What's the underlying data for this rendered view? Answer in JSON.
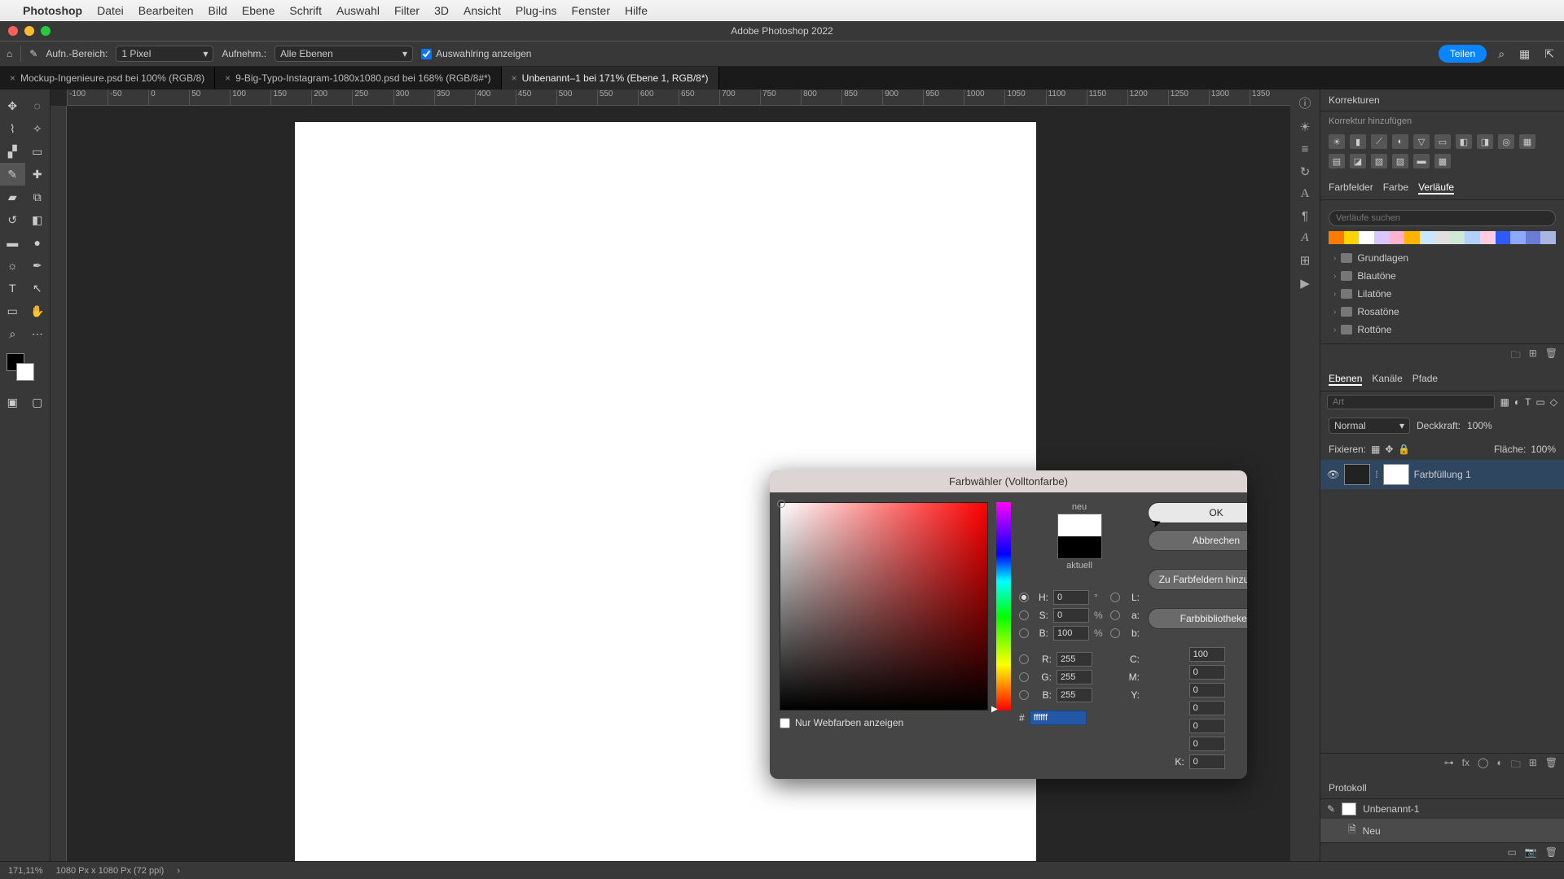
{
  "menubar": {
    "app": "Photoshop",
    "items": [
      "Datei",
      "Bearbeiten",
      "Bild",
      "Ebene",
      "Schrift",
      "Auswahl",
      "Filter",
      "3D",
      "Ansicht",
      "Plug-ins",
      "Fenster",
      "Hilfe"
    ]
  },
  "window_title": "Adobe Photoshop 2022",
  "optbar": {
    "aufn_label": "Aufn.-Bereich:",
    "aufn_val": "1 Pixel",
    "aufnehm_label": "Aufnehm.:",
    "aufnehm_val": "Alle Ebenen",
    "ring": "Auswahlring anzeigen",
    "share": "Teilen"
  },
  "tabs": [
    {
      "label": "Mockup-Ingenieure.psd bei 100% (RGB/8)"
    },
    {
      "label": "9-Big-Typo-Instagram-1080x1080.psd bei 168% (RGB/8#*)"
    },
    {
      "label": "Unbenannt–1 bei 171% (Ebene 1, RGB/8*)",
      "active": true
    }
  ],
  "ruler_ticks": [
    "-100",
    "-50",
    "0",
    "50",
    "100",
    "150",
    "200",
    "250",
    "300",
    "350",
    "400",
    "450",
    "500",
    "550",
    "600",
    "650",
    "700",
    "750",
    "800",
    "850",
    "900",
    "950",
    "1000",
    "1050",
    "1100",
    "1150",
    "1200",
    "1250",
    "1300",
    "1350"
  ],
  "panels": {
    "korrekturen": "Korrekturen",
    "korrektur_add": "Korrektur hinzufügen",
    "swatch_tabs": [
      "Farbfelder",
      "Farbe",
      "Verläufe"
    ],
    "search_ph": "Verläufe suchen",
    "tree": [
      "Grundlagen",
      "Blautöne",
      "Lilatöne",
      "Rosatöne",
      "Rottöne"
    ],
    "layer_tabs": [
      "Ebenen",
      "Kanäle",
      "Pfade"
    ],
    "art_ph": "Art",
    "blend": "Normal",
    "opacity_l": "Deckkraft:",
    "opacity_v": "100%",
    "lock_l": "Fixieren:",
    "fill_l": "Fläche:",
    "fill_v": "100%",
    "layer_name": "Farbfüllung 1",
    "protokoll": "Protokoll",
    "prot_items": [
      "Unbenannt-1",
      "Neu"
    ]
  },
  "status": {
    "zoom": "171,11%",
    "dim": "1080 Px x 1080 Px (72 ppi)"
  },
  "picker": {
    "title": "Farbwähler (Volltonfarbe)",
    "neu": "neu",
    "aktuell": "aktuell",
    "ok": "OK",
    "cancel": "Abbrechen",
    "add": "Zu Farbfeldern hinzufügen",
    "libs": "Farbbibliotheken",
    "webonly": "Nur Webfarben anzeigen",
    "H": "0",
    "S": "0",
    "B": "100",
    "R": "255",
    "G": "255",
    "Bl": "255",
    "L": "100",
    "a": "0",
    "b": "0",
    "C": "0",
    "M": "0",
    "Y": "0",
    "K": "0",
    "hex": "ffffff"
  },
  "grad_colors": [
    "#ff7a00",
    "#ffd400",
    "#ffffff",
    "#d9c6ff",
    "#ffb3d1",
    "#ffb300",
    "#c8e6ff",
    "#e0e0e0",
    "#cfe8d5",
    "#b3d1ff",
    "#ffcce0",
    "#2d5bff",
    "#8fa8ff",
    "#6b7bd6",
    "#aab5e0"
  ]
}
